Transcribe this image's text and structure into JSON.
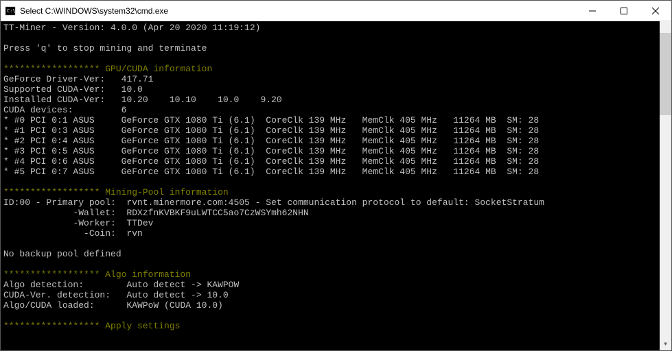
{
  "titlebar": {
    "title": "Select C:\\WINDOWS\\system32\\cmd.exe"
  },
  "header": {
    "version_line": "TT-Miner - Version: 4.0.0 (Apr 20 2020 11:19:12)",
    "quit_line": "Press 'q' to stop mining and terminate"
  },
  "gpu_section": {
    "asterisks": "******************",
    "title": " GPU/CUDA information",
    "driver_label": "GeForce Driver-Ver:   ",
    "driver_value": "417.71",
    "supported_label": "Supported CUDA-Ver:   ",
    "supported_value": "10.0",
    "installed_label": "Installed CUDA-Ver:   ",
    "installed_value": "10.20    10.10    10.0    9.20",
    "devices_label": "CUDA devices:         ",
    "devices_value": "6",
    "gpus": [
      "* #0 PCI 0:1 ASUS     GeForce GTX 1080 Ti (6.1)  CoreClk 139 MHz   MemClk 405 MHz   11264 MB  SM: 28",
      "* #1 PCI 0:3 ASUS     GeForce GTX 1080 Ti (6.1)  CoreClk 139 MHz   MemClk 405 MHz   11264 MB  SM: 28",
      "* #2 PCI 0:4 ASUS     GeForce GTX 1080 Ti (6.1)  CoreClk 139 MHz   MemClk 405 MHz   11264 MB  SM: 28",
      "* #3 PCI 0:5 ASUS     GeForce GTX 1080 Ti (6.1)  CoreClk 139 MHz   MemClk 405 MHz   11264 MB  SM: 28",
      "* #4 PCI 0:6 ASUS     GeForce GTX 1080 Ti (6.1)  CoreClk 139 MHz   MemClk 405 MHz   11264 MB  SM: 28",
      "* #5 PCI 0:7 ASUS     GeForce GTX 1080 Ti (6.1)  CoreClk 139 MHz   MemClk 405 MHz   11264 MB  SM: 28"
    ]
  },
  "pool_section": {
    "asterisks": "******************",
    "title": " Mining-Pool information",
    "primary_line": "ID:00 - Primary pool:  rvnt.minermore.com:4505 - Set communication protocol to default: SocketStratum",
    "wallet_line": "             -Wallet:  RDXzfnKVBKF9uLWTCC5ao7CzWSYmh62NHN",
    "worker_line": "             -Worker:  TTDev",
    "coin_line": "               -Coin:  rvn",
    "no_backup": "No backup pool defined"
  },
  "algo_section": {
    "asterisks": "******************",
    "title": " Algo information",
    "detection_line": "Algo detection:        Auto detect -> KAWPOW",
    "cuda_detection_line": "CUDA-Ver. detection:   Auto detect -> 10.0",
    "loaded_line": "Algo/CUDA loaded:      KAWPoW (CUDA 10.0)"
  },
  "apply_section": {
    "asterisks": "******************",
    "title": " Apply settings"
  }
}
